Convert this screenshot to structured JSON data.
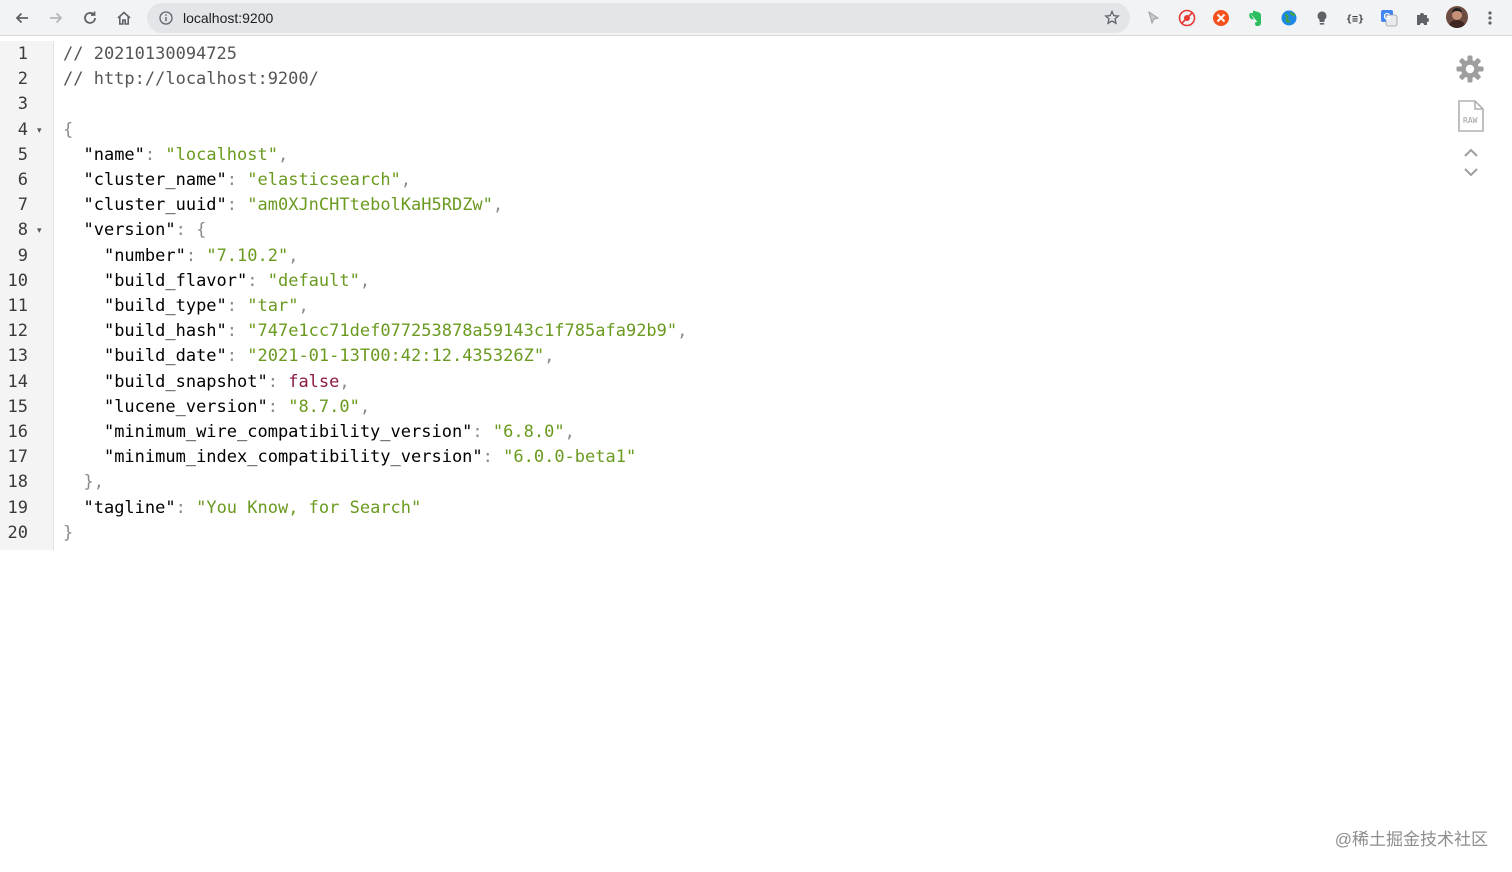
{
  "browser": {
    "url": "localhost:9200"
  },
  "gutter": {
    "line_numbers": [
      "1",
      "2",
      "3",
      "4",
      "5",
      "6",
      "7",
      "8",
      "9",
      "10",
      "11",
      "12",
      "13",
      "14",
      "15",
      "16",
      "17",
      "18",
      "19",
      "20"
    ],
    "fold_marker": "▾"
  },
  "json_view": {
    "comment_date": "// 20210130094725",
    "comment_url": "// http://localhost:9200/",
    "open_brace": "{",
    "close_brace": "}",
    "name_key": "\"name\"",
    "name_value": "\"localhost\"",
    "cluster_name_key": "\"cluster_name\"",
    "cluster_name_value": "\"elasticsearch\"",
    "cluster_uuid_key": "\"cluster_uuid\"",
    "cluster_uuid_value": "\"am0XJnCHTtebolKaH5RDZw\"",
    "version_key": "\"version\"",
    "version_open": "{",
    "version_close": "},",
    "number_key": "\"number\"",
    "number_value": "\"7.10.2\"",
    "build_flavor_key": "\"build_flavor\"",
    "build_flavor_value": "\"default\"",
    "build_type_key": "\"build_type\"",
    "build_type_value": "\"tar\"",
    "build_hash_key": "\"build_hash\"",
    "build_hash_value": "\"747e1cc71def077253878a59143c1f785afa92b9\"",
    "build_date_key": "\"build_date\"",
    "build_date_value": "\"2021-01-13T00:42:12.435326Z\"",
    "build_snapshot_key": "\"build_snapshot\"",
    "build_snapshot_value": "false",
    "lucene_version_key": "\"lucene_version\"",
    "lucene_version_value": "\"8.7.0\"",
    "min_wire_key": "\"minimum_wire_compatibility_version\"",
    "min_wire_value": "\"6.8.0\"",
    "min_index_key": "\"minimum_index_compatibility_version\"",
    "min_index_value": "\"6.0.0-beta1\"",
    "tagline_key": "\"tagline\"",
    "tagline_value": "\"You Know, for Search\""
  },
  "side_tools": {
    "raw_label": "RAW"
  },
  "watermark": "@稀土掘金技术社区",
  "colors": {
    "string": "#6a9a1f",
    "boolean": "#8b1a45",
    "punctuation": "#8a8a8a",
    "toolbar_bg": "#f1f3f4",
    "omnibox_bg": "#e3e5e8"
  },
  "icons": [
    "back-icon",
    "forward-icon",
    "reload-icon",
    "home-icon",
    "info-icon",
    "star-icon",
    "cursor-extension-icon",
    "block-extension-icon",
    "orange-extension-icon",
    "evernote-extension-icon",
    "globe-extension-icon",
    "bulb-extension-icon",
    "json-extension-icon",
    "translate-extension-icon",
    "puzzle-extension-icon",
    "avatar",
    "kebab-menu-icon",
    "gear-icon",
    "raw-file-icon",
    "chevron-up-icon",
    "chevron-down-icon"
  ]
}
